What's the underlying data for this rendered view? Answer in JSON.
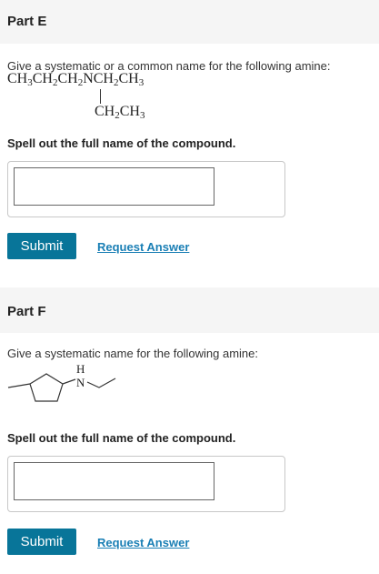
{
  "partE": {
    "title": "Part E",
    "question": "Give a systematic or a common name for the following amine:",
    "formula_main": {
      "t1": "CH",
      "s1": "3",
      "t2": "CH",
      "s2": "2",
      "t3": "CH",
      "s3": "2",
      "t4": "NCH",
      "s4": "2",
      "t5": "CH",
      "s5": "3"
    },
    "formula_branch": {
      "t1": "CH",
      "s1": "2",
      "t2": "CH",
      "s2": "3"
    },
    "spell": "Spell out the full name of the compound.",
    "input_value": "",
    "submit_label": "Submit",
    "request_label": "Request Answer"
  },
  "partF": {
    "title": "Part F",
    "question": "Give a systematic name for the following amine:",
    "structure_labels": {
      "h": "H",
      "n": "N"
    },
    "spell": "Spell out the full name of the compound.",
    "input_value": "",
    "submit_label": "Submit",
    "request_label": "Request Answer"
  },
  "colors": {
    "button": "#087599",
    "link": "#1a7fb5",
    "header_bg": "#f5f5f5"
  }
}
